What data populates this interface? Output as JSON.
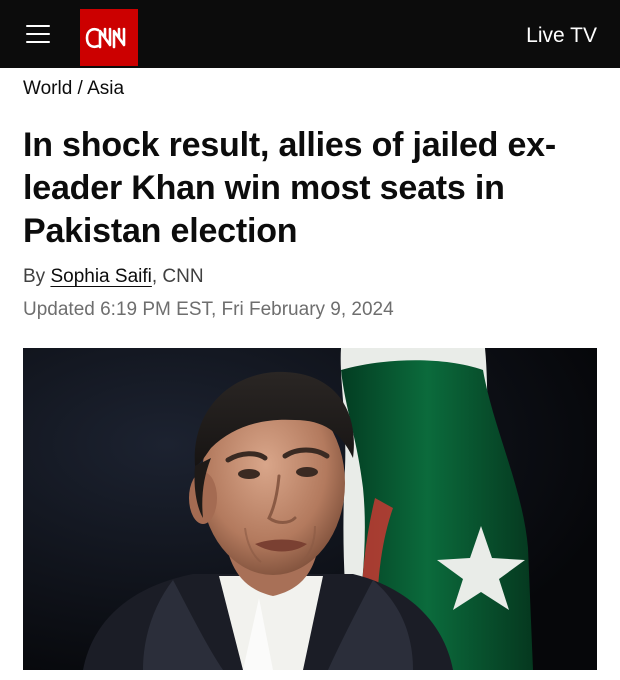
{
  "topbar": {
    "menu_icon": "hamburger-menu-icon",
    "logo_text": "CNN",
    "live_tv_label": "Live TV",
    "background_color": "#0c0c0c",
    "logo_color": "#cc0000"
  },
  "breadcrumb": {
    "section": "World",
    "separator": " / ",
    "subsection": "Asia"
  },
  "article": {
    "headline": "In shock result, allies of jailed ex-leader Khan win most seats in Pakistan election",
    "byline_prefix": "By ",
    "author": "Sophia Saifi",
    "byline_suffix": ", CNN",
    "timestamp": "Updated 6:19 PM EST, Fri February 9, 2024"
  },
  "hero_image": {
    "subject": "portrait-photo",
    "flag_colors": [
      "#01411c",
      "#ffffff"
    ]
  }
}
